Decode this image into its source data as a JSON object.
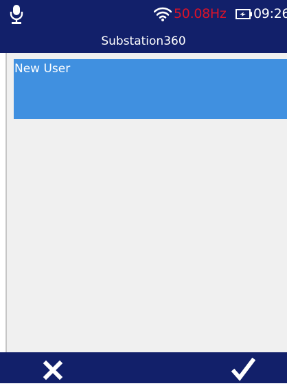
{
  "status_bar": {
    "frequency": "50.08Hz",
    "time": "09:26",
    "icons": [
      "microphone-icon",
      "wifi-icon",
      "battery-charging-icon"
    ],
    "colors": {
      "bar_bg": "#12206a",
      "frequency": "#d8132a",
      "text": "#ffffff"
    }
  },
  "header": {
    "title": "Substation360"
  },
  "user_list": {
    "items": [
      {
        "label": "New User",
        "selected": true
      }
    ],
    "colors": {
      "selected_bg": "#4090e0",
      "list_bg": "#f0f0f0"
    }
  },
  "footer": {
    "cancel_icon": "close-icon",
    "confirm_icon": "checkmark-icon"
  }
}
